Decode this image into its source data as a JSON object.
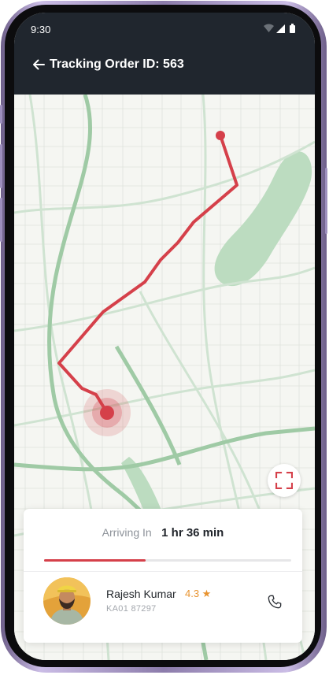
{
  "status_bar": {
    "time": "9:30"
  },
  "header": {
    "title": "Tracking Order ID: 563"
  },
  "tracking": {
    "arriving_label": "Arriving In",
    "eta": "1 hr 36 min",
    "progress_fraction": 0.41
  },
  "driver": {
    "name": "Rajesh Kumar",
    "rating": "4.3 ★",
    "vehicle_number": "KA01 87297"
  },
  "colors": {
    "header_bg": "#20262e",
    "route": "#d5404a",
    "rating": "#e8932f",
    "map_road": "#b9d6bd",
    "map_park": "#bcdcc0"
  },
  "icons": {
    "back": "arrow-left-icon",
    "expand": "fullscreen-icon",
    "call": "phone-icon",
    "location": "pulse-location-icon"
  }
}
